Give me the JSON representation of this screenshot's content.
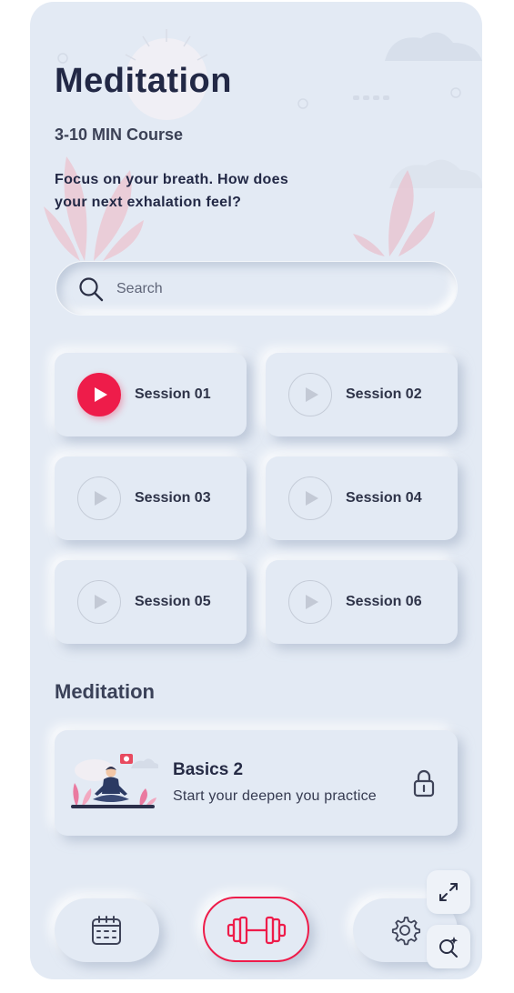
{
  "header": {
    "title": "Meditation",
    "course_length": "3-10 MIN Course",
    "description": "Focus on your breath. How does your next exhalation feel?"
  },
  "search": {
    "placeholder": "Search",
    "value": ""
  },
  "sessions": [
    {
      "label": "Session 01",
      "active": true
    },
    {
      "label": "Session 02",
      "active": false
    },
    {
      "label": "Session 03",
      "active": false
    },
    {
      "label": "Session 04",
      "active": false
    },
    {
      "label": "Session 05",
      "active": false
    },
    {
      "label": "Session 06",
      "active": false
    }
  ],
  "section": {
    "title": "Meditation"
  },
  "course": {
    "title": "Basics 2",
    "subtitle": "Start your deepen you practice",
    "locked": true
  },
  "nav": {
    "items": [
      {
        "icon": "calendar-icon",
        "active": false
      },
      {
        "icon": "dumbbell-icon",
        "active": true
      },
      {
        "icon": "gear-icon",
        "active": false
      }
    ]
  },
  "floating_tools": [
    {
      "icon": "expand-icon"
    },
    {
      "icon": "search-sparkle-icon"
    }
  ],
  "colors": {
    "background": "#e3eaf4",
    "accent": "#ee1c4a",
    "text": "#222845"
  }
}
